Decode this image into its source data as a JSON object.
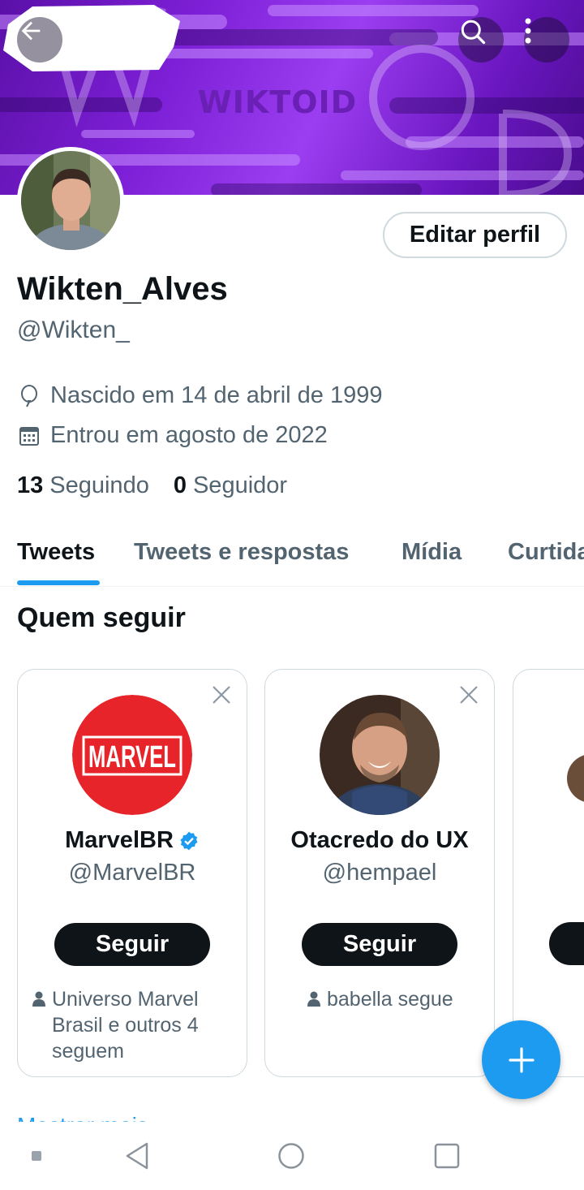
{
  "banner": {
    "logo_text": "WIKTOID"
  },
  "header": {
    "back_icon": "arrow-left-icon",
    "search_icon": "search-icon",
    "more_icon": "more-vertical-icon"
  },
  "profile": {
    "edit_label": "Editar perfil",
    "display_name": "Wikten_Alves",
    "handle": "@Wikten_",
    "birth": "Nascido em 14 de abril de 1999",
    "joined": "Entrou em agosto de 2022",
    "following_count": "13",
    "following_label": "Seguindo",
    "followers_count": "0",
    "followers_label": "Seguidor"
  },
  "tabs": [
    "Tweets",
    "Tweets e respostas",
    "Mídia",
    "Curtidas"
  ],
  "who_to_follow": {
    "title": "Quem seguir",
    "cards": [
      {
        "name": "MarvelBR",
        "handle": "@MarvelBR",
        "button": "Seguir",
        "social": "Universo Marvel Brasil e outros 4 seguem",
        "logo_text": "MARVEL",
        "verified": true
      },
      {
        "name": "Otacredo do UX",
        "handle": "@hempael",
        "button": "Seguir",
        "social": "babella segue",
        "verified": false
      }
    ],
    "more_link": "Mostrar mais"
  },
  "colors": {
    "accent": "#1d9bf0",
    "text": "#0f1419",
    "muted": "#536471",
    "border": "#cfd9de",
    "marvel_red": "#e62429"
  },
  "navbar": {
    "icons": [
      "square-dot-icon",
      "back-triangle-icon",
      "home-circle-icon",
      "recents-square-icon"
    ]
  }
}
